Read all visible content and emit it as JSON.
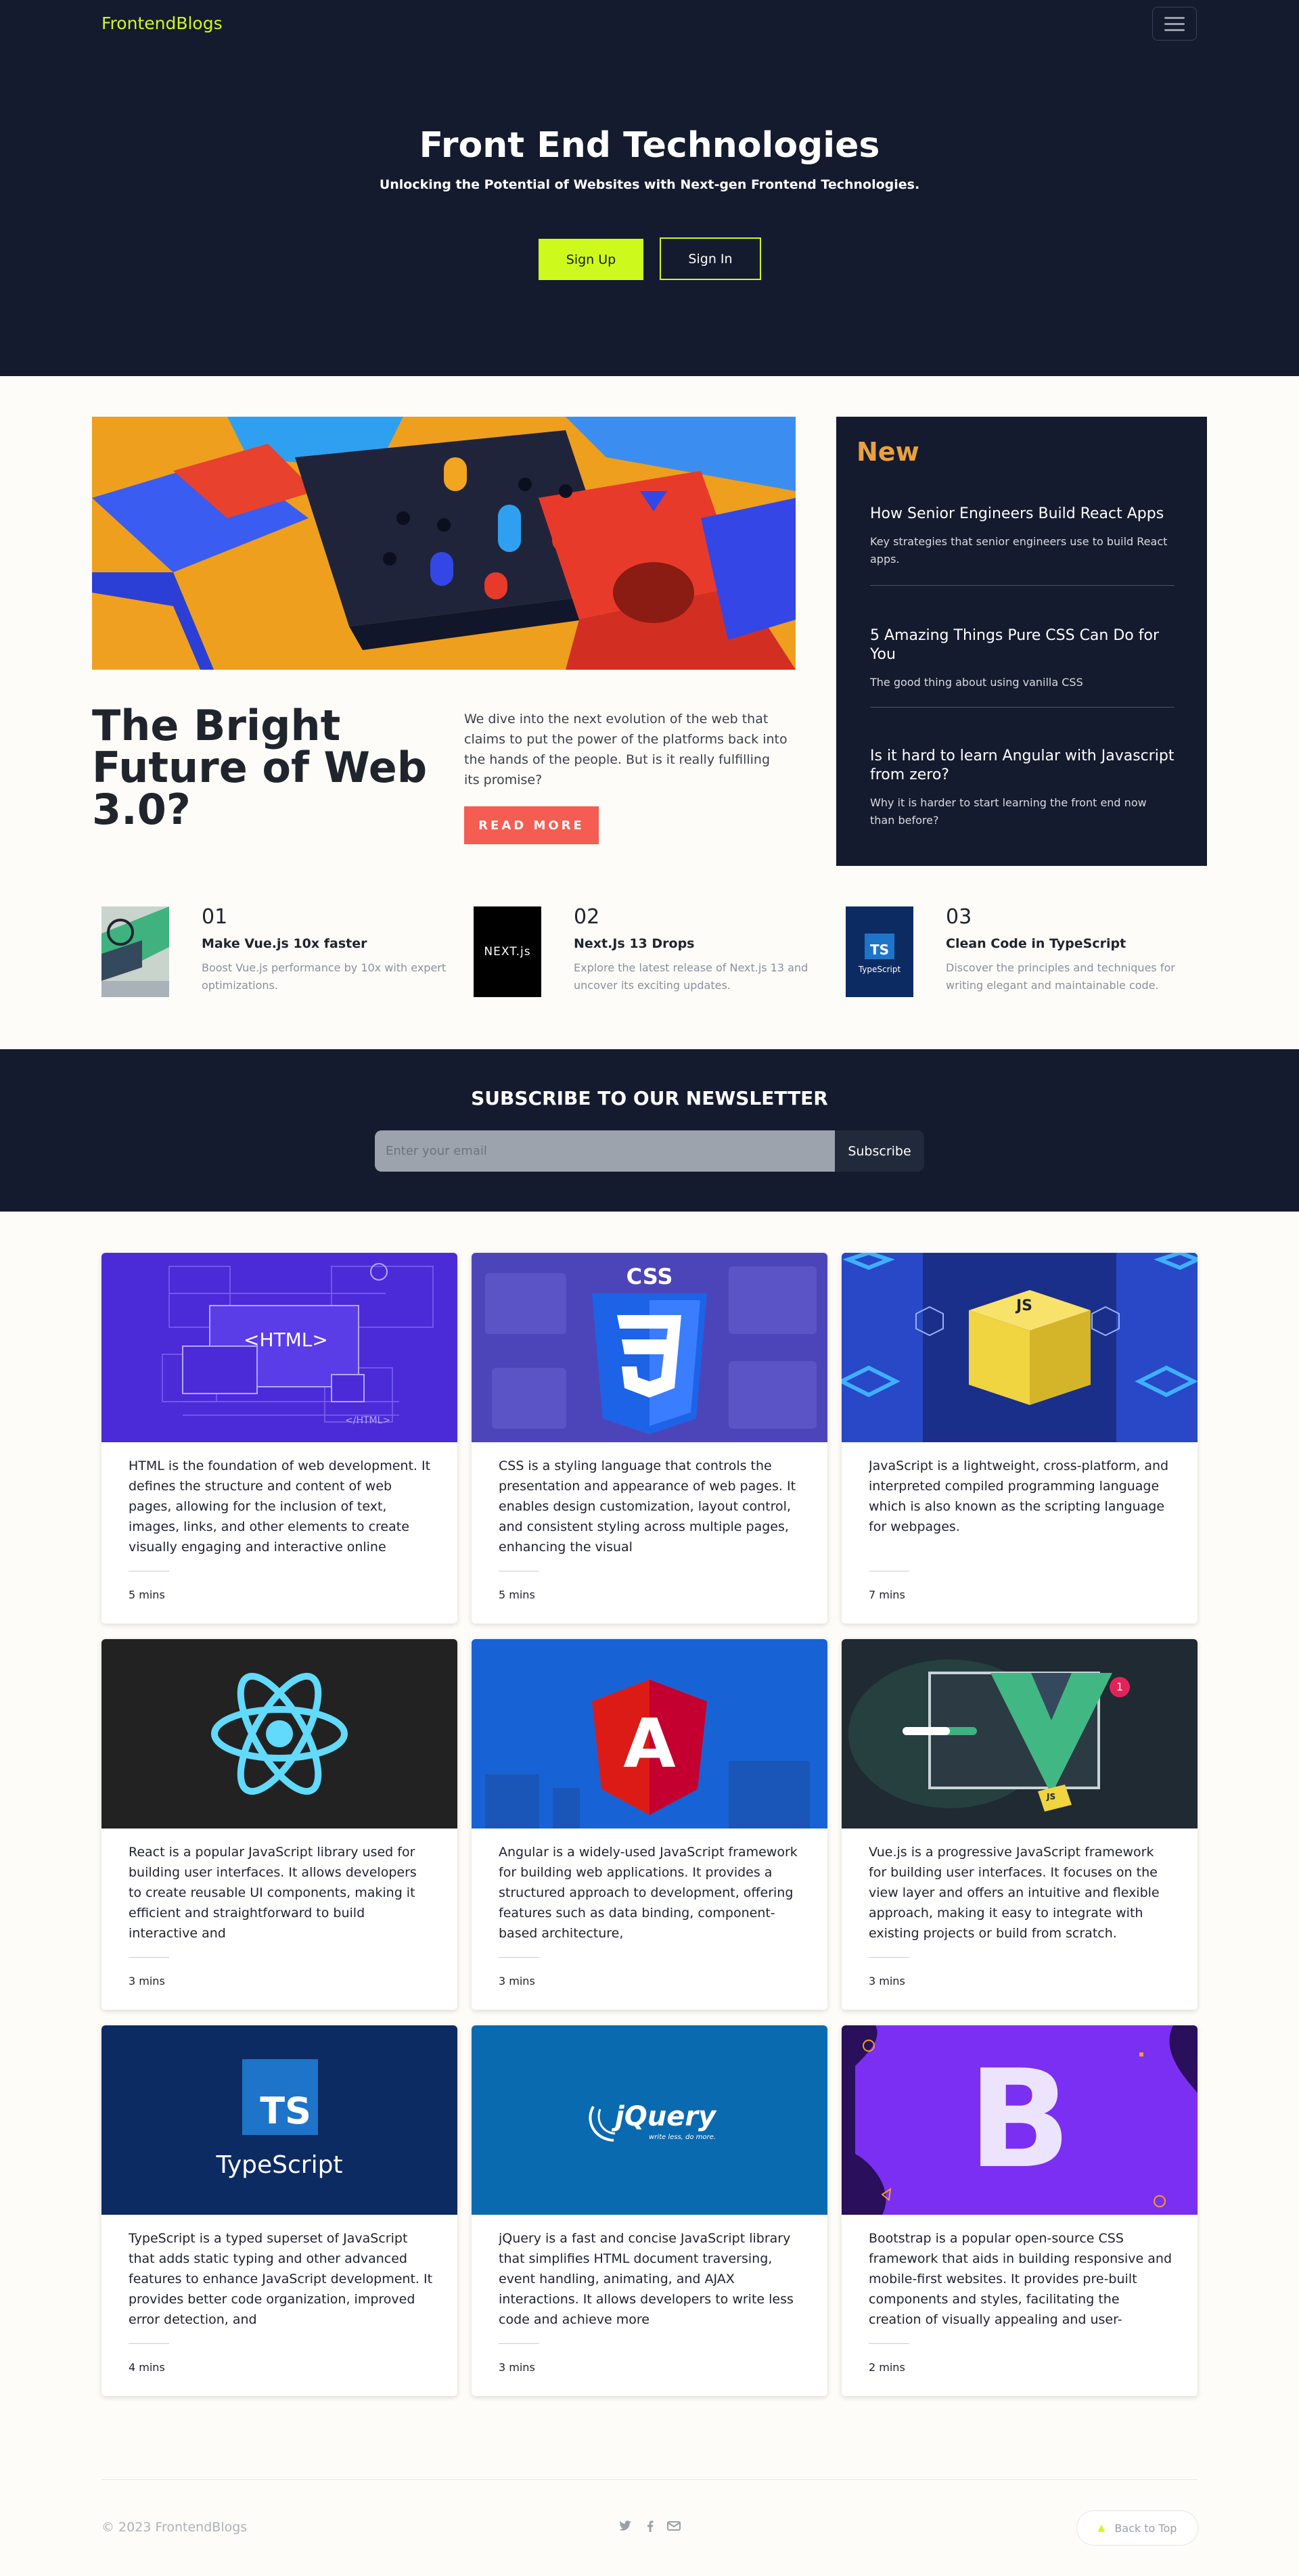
{
  "nav": {
    "brand": "FrontendBlogs"
  },
  "hero": {
    "title": "Front End Technologies",
    "subtitle": "Unlocking the Potential of Websites with Next-gen Frontend Technologies.",
    "signup_label": "Sign Up",
    "signin_label": "Sign In"
  },
  "feature": {
    "title": "The Bright Future of Web 3.0?",
    "description": "We dive into the next evolution of the web that claims to put the power of the platforms back into the hands of the people. But is it really fulfilling its promise?",
    "read_more": "READ MORE"
  },
  "new_panel": {
    "label": "New",
    "items": [
      {
        "title": "How Senior Engineers Build React Apps",
        "text": "Key strategies that senior engineers use to build React apps."
      },
      {
        "title": "5 Amazing Things Pure CSS Can Do for You",
        "text": "The good thing about using vanilla CSS"
      },
      {
        "title": "Is it hard to learn Angular with Javascript from zero?",
        "text": "Why it is harder to start learning the front end now than before?"
      }
    ]
  },
  "numbered": [
    {
      "num": "01",
      "title": "Make Vue.js 10x faster",
      "text": "Boost Vue.js performance by 10x with expert optimizations."
    },
    {
      "num": "02",
      "title": "Next.Js 13 Drops",
      "text": "Explore the latest release of Next.js 13 and uncover its exciting updates.",
      "logo": "NEXT.js"
    },
    {
      "num": "03",
      "title": "Clean Code in TypeScript",
      "text": "Discover the principles and techniques for writing elegant and maintainable code.",
      "logo_badge": "TS",
      "logo_word": "TypeScript"
    }
  ],
  "newsletter": {
    "title": "SUBSCRIBE TO OUR NEWSLETTER",
    "placeholder": "Enter your email",
    "button": "Subscribe"
  },
  "cards": [
    {
      "img_text": "<HTML>",
      "img_caption": "</HTML>",
      "text": "HTML is the foundation of web development. It defines the structure and content of web pages, allowing for the inclusion of text, images, links, and other elements to create visually engaging and interactive online",
      "time": "5 mins"
    },
    {
      "img_text": "CSS",
      "img_badge": "3",
      "text": "CSS is a styling language that controls the presentation and appearance of web pages. It enables design customization, layout control, and consistent styling across multiple pages, enhancing the visual",
      "time": "5 mins"
    },
    {
      "img_text": "JS",
      "text": "JavaScript is a lightweight, cross-platform, and interpreted compiled programming language which is also known as the scripting language for webpages.",
      "time": "7 mins"
    },
    {
      "text": "React is a popular JavaScript library used for building user interfaces. It allows developers to create reusable UI components, making it efficient and straightforward to build interactive and",
      "time": "3 mins"
    },
    {
      "img_text": "A",
      "text": "Angular is a widely-used JavaScript framework for building web applications. It provides a structured approach to development, offering features such as data binding, component-based architecture,",
      "time": "3 mins"
    },
    {
      "img_badge": "1",
      "img_text": "JS",
      "text": "Vue.js is a progressive JavaScript framework for building user interfaces. It focuses on the view layer and offers an intuitive and flexible approach, making it easy to integrate with existing projects or build from scratch.",
      "time": "3 mins"
    },
    {
      "img_badge": "TS",
      "img_text": "TypeScript",
      "text": "TypeScript is a typed superset of JavaScript that adds static typing and other advanced features to enhance JavaScript development. It provides better code organization, improved error detection, and",
      "time": "4 mins"
    },
    {
      "img_text": "jQuery",
      "img_caption": "write less, do more.",
      "text": "jQuery is a fast and concise JavaScript library that simplifies HTML document traversing, event handling, animating, and AJAX interactions. It allows developers to write less code and achieve more",
      "time": "3 mins"
    },
    {
      "img_text": "B",
      "text": "Bootstrap is a popular open-source CSS framework that aids in building responsive and mobile-first websites. It provides pre-built components and styles, facilitating the creation of visually appealing and user-",
      "time": "2 mins"
    }
  ],
  "footer": {
    "copyright": "© 2023 FrontendBlogs",
    "back_to_top": "Back to Top"
  },
  "colors": {
    "navy": "#151b2e",
    "lime": "#cdfa1c",
    "coral": "#f55c52",
    "amber": "#e9a13f",
    "paper": "#fdfcf8"
  }
}
